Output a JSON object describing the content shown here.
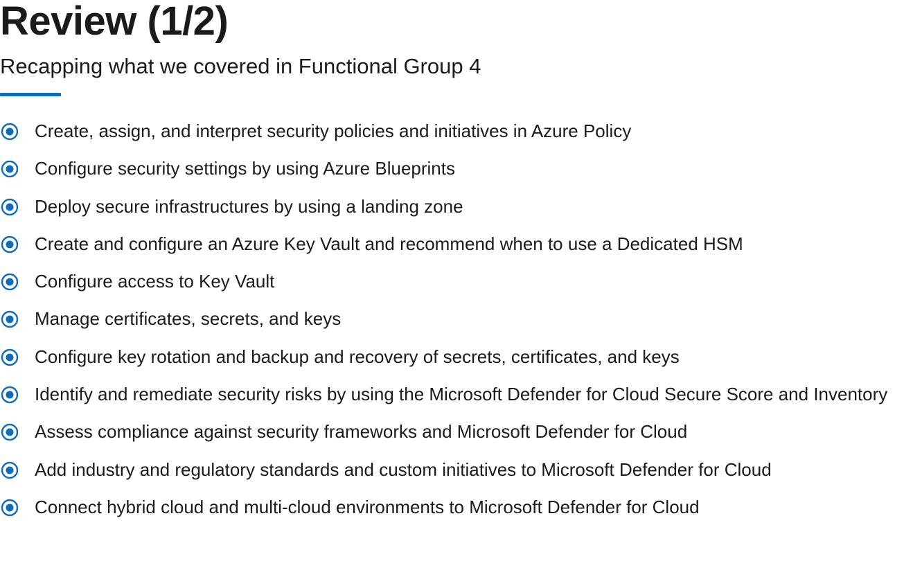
{
  "slide": {
    "title": "Review (1/2)",
    "subtitle": "Recapping what we covered in Functional Group 4",
    "accent_color": "#0f6cbd",
    "bullet_icon": "radio-selected-icon",
    "items": [
      "Create, assign, and interpret security policies and initiatives in Azure Policy",
      "Configure security settings by using Azure Blueprints",
      "Deploy secure infrastructures by using a landing zone",
      "Create and configure an Azure Key Vault and recommend when to use a Dedicated HSM",
      "Configure access to Key Vault",
      "Manage certificates, secrets, and keys",
      "Configure key rotation and backup and recovery of secrets, certificates, and keys",
      "Identify and remediate security risks by using the Microsoft Defender for Cloud Secure Score and Inventory",
      "Assess compliance against security frameworks and Microsoft Defender for Cloud",
      "Add industry and regulatory standards and custom initiatives to Microsoft Defender for Cloud",
      "Connect hybrid cloud and multi-cloud environments to Microsoft Defender for Cloud"
    ]
  }
}
